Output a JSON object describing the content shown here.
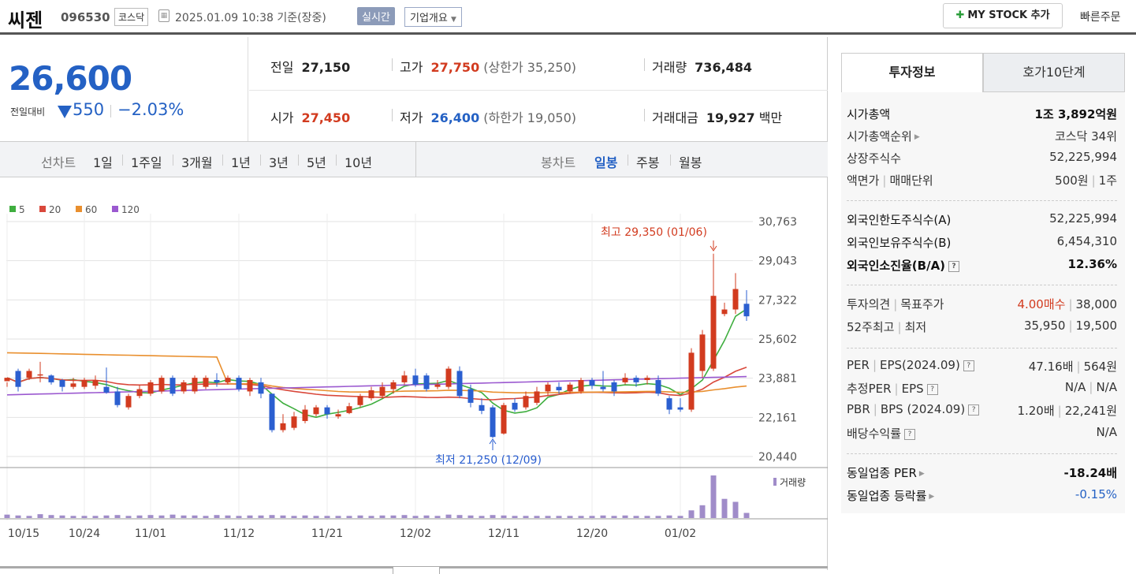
{
  "header": {
    "name": "씨젠",
    "code": "096530",
    "market": "코스닥",
    "datetime": "2025.01.09 10:38  기준(장중)",
    "live_label": "실시간",
    "corp_label": "기업개요",
    "mystock_label": "MY STOCK 추가",
    "quick_label": "빠른주문"
  },
  "price": {
    "current": "26,600",
    "diff_label": "전일대비",
    "change": "550",
    "change_pct": "−2.03%"
  },
  "quote": {
    "prev_label": "전일",
    "prev": "27,150",
    "high_label": "고가",
    "high": "27,750",
    "upper": "(상한가 35,250)",
    "volume_label": "거래량",
    "volume": "736,484",
    "open_label": "시가",
    "open": "27,450",
    "low_label": "저가",
    "low": "26,400",
    "lower": "(하한가 19,050)",
    "amount_label": "거래대금",
    "amount": "19,927",
    "amount_unit": "백만"
  },
  "periods": {
    "label": "선차트",
    "items": [
      "1일",
      "1주일",
      "3개월",
      "1년",
      "3년",
      "5년",
      "10년"
    ],
    "candle_label": "봉차트",
    "candle_items": [
      "일봉",
      "주봉",
      "월봉"
    ],
    "candle_selected": "일봉"
  },
  "chart_data": {
    "type": "candlestick",
    "legend": [
      {
        "name": "5",
        "color": "#3fae3f"
      },
      {
        "name": "20",
        "color": "#d9483b"
      },
      {
        "name": "60",
        "color": "#e98f2e"
      },
      {
        "name": "120",
        "color": "#9b59d0"
      }
    ],
    "y_ticks": [
      "30,763",
      "29,043",
      "27,322",
      "25,602",
      "23,881",
      "22,161",
      "20,440"
    ],
    "ylim": [
      20440,
      30763
    ],
    "x_ticks": [
      "10/15",
      "10/24",
      "11/01",
      "11/12",
      "11/21",
      "12/02",
      "12/11",
      "12/20",
      "01/02"
    ],
    "high_note": "최고 29,350 (01/06)",
    "low_note": "최저 21,250 (12/09)",
    "volume_label": "거래량",
    "candles": [
      [
        23750,
        23900,
        23700,
        23500
      ],
      [
        24200,
        23500,
        24300,
        23300
      ],
      [
        23900,
        24200,
        24300,
        23800
      ],
      [
        24000,
        24050,
        24600,
        23700
      ],
      [
        24000,
        23700,
        24050,
        23600
      ],
      [
        23800,
        23500,
        23850,
        23300
      ],
      [
        23500,
        23650,
        23900,
        23400
      ],
      [
        23500,
        23800,
        23900,
        23400
      ],
      [
        23550,
        23800,
        24000,
        23400
      ],
      [
        23500,
        23250,
        24350,
        23200
      ],
      [
        23300,
        22700,
        23500,
        22600
      ],
      [
        22600,
        23100,
        23200,
        22500
      ],
      [
        23100,
        23400,
        23600,
        23000
      ],
      [
        23200,
        23700,
        23800,
        23100
      ],
      [
        23300,
        23900,
        24000,
        23200
      ],
      [
        23900,
        23200,
        24000,
        23100
      ],
      [
        23300,
        23700,
        23800,
        23200
      ],
      [
        23300,
        23900,
        24000,
        23200
      ],
      [
        23500,
        23900,
        24000,
        23400
      ],
      [
        23800,
        23700,
        24100,
        23500
      ],
      [
        23700,
        23900,
        24000,
        23600
      ],
      [
        23900,
        23400,
        24000,
        23300
      ],
      [
        23300,
        23800,
        23900,
        23100
      ],
      [
        23700,
        23200,
        23900,
        23000
      ],
      [
        23200,
        21600,
        23200,
        21500
      ],
      [
        21600,
        21900,
        22300,
        21500
      ],
      [
        21700,
        22200,
        22400,
        21600
      ],
      [
        22000,
        22500,
        22700,
        21900
      ],
      [
        22300,
        22600,
        22700,
        22200
      ],
      [
        22600,
        22300,
        22700,
        22100
      ],
      [
        22200,
        22300,
        22500,
        22100
      ],
      [
        22350,
        22650,
        22800,
        22300
      ],
      [
        22700,
        23100,
        23200,
        22600
      ],
      [
        23000,
        23350,
        23500,
        22900
      ],
      [
        23100,
        23500,
        23700,
        23000
      ],
      [
        23400,
        23700,
        23800,
        23200
      ],
      [
        23700,
        24000,
        24200,
        23600
      ],
      [
        24000,
        23600,
        24300,
        23500
      ],
      [
        24000,
        23400,
        24100,
        23300
      ],
      [
        23500,
        23600,
        23800,
        23400
      ],
      [
        23500,
        24300,
        24400,
        23400
      ],
      [
        24200,
        23100,
        24400,
        23000
      ],
      [
        23400,
        22800,
        23600,
        22600
      ],
      [
        22700,
        22450,
        23000,
        22300
      ],
      [
        22600,
        21300,
        22700,
        21250
      ],
      [
        21450,
        22700,
        22800,
        21400
      ],
      [
        22800,
        22500,
        23000,
        22400
      ],
      [
        22600,
        23100,
        23300,
        22500
      ],
      [
        22800,
        23300,
        23500,
        22700
      ],
      [
        23300,
        23600,
        23700,
        23100
      ],
      [
        23500,
        23350,
        23700,
        23200
      ],
      [
        23300,
        23600,
        23700,
        23200
      ],
      [
        23300,
        23800,
        23900,
        23200
      ],
      [
        23800,
        23550,
        23900,
        23400
      ],
      [
        23500,
        23400,
        24200,
        23300
      ],
      [
        23700,
        23300,
        23800,
        23100
      ],
      [
        23700,
        23900,
        24100,
        23600
      ],
      [
        23900,
        23700,
        24000,
        23500
      ],
      [
        23800,
        23900,
        24000,
        23600
      ],
      [
        23800,
        23200,
        24000,
        23100
      ],
      [
        23000,
        22500,
        23100,
        22300
      ],
      [
        22600,
        22500,
        23000,
        22400
      ],
      [
        22500,
        25000,
        25200,
        22400
      ],
      [
        24200,
        25800,
        26000,
        23900
      ],
      [
        24300,
        27500,
        29350,
        24200
      ],
      [
        26700,
        26900,
        27200,
        26600
      ],
      [
        26900,
        27800,
        28500,
        26700
      ],
      [
        27150,
        26600,
        27750,
        26400
      ]
    ],
    "volumes": [
      8,
      6,
      5,
      9,
      7,
      6,
      5,
      5,
      5,
      6,
      7,
      5,
      6,
      7,
      6,
      8,
      6,
      6,
      5,
      7,
      6,
      5,
      6,
      6,
      7,
      6,
      5,
      6,
      5,
      5,
      5,
      5,
      6,
      5,
      6,
      6,
      7,
      5,
      6,
      5,
      8,
      7,
      6,
      5,
      7,
      6,
      5,
      5,
      5,
      5,
      5,
      5,
      5,
      5,
      6,
      5,
      6,
      5,
      5,
      5,
      6,
      5,
      18,
      30,
      100,
      45,
      38,
      12
    ]
  },
  "invest": {
    "tab1": "투자정보",
    "tab2": "호가10단계",
    "rows": [
      {
        "l": "시가총액",
        "r": "1조 3,892억원"
      },
      {
        "l": "시가총액순위",
        "r": "코스닥 34위"
      },
      {
        "l": "상장주식수",
        "r": "52,225,994"
      },
      {
        "l": "액면가",
        "l2": "매매단위",
        "r": "500원",
        "r2": "1주"
      },
      {
        "l": "외국인한도주식수(A)",
        "r": "52,225,994"
      },
      {
        "l": "외국인보유주식수(B)",
        "r": "6,454,310"
      },
      {
        "l": "외국인소진율(B/A)",
        "r": "12.36%"
      },
      {
        "l": "투자의견",
        "l2": "목표주가",
        "r": "4.00매수",
        "r2": "38,000"
      },
      {
        "l": "52주최고",
        "l2": "최저",
        "r": "35,950",
        "r2": "19,500"
      },
      {
        "l": "PER",
        "l2": "EPS(2024.09)",
        "r": "47.16배",
        "r2": "564원"
      },
      {
        "l": "추정PER",
        "l2": "EPS",
        "r": "N/A",
        "r2": "N/A"
      },
      {
        "l": "PBR",
        "l2": "BPS (2024.09)",
        "r": "1.20배",
        "r2": "22,241원"
      },
      {
        "l": "배당수익률",
        "r": "N/A"
      },
      {
        "l": "동일업종 PER",
        "r": "-18.24배"
      },
      {
        "l": "동일업종 등락률",
        "r": "-0.15%"
      }
    ]
  }
}
